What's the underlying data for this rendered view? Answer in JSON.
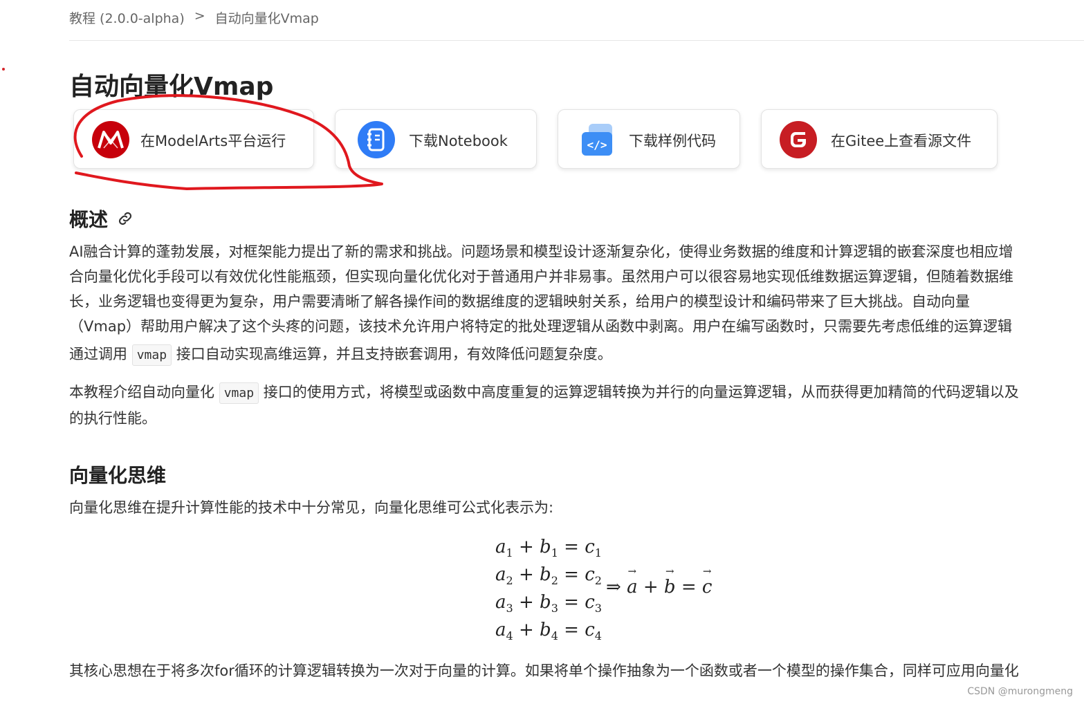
{
  "breadcrumb": {
    "parent": "教程 (2.0.0-alpha)",
    "separator": ">",
    "current": "自动向量化Vmap"
  },
  "page_title": "自动向量化Vmap",
  "cards": [
    {
      "label": "在ModelArts平台运行",
      "icon": "modelarts-icon",
      "color": "#c7000b"
    },
    {
      "label": "下载Notebook",
      "icon": "notebook-icon",
      "color": "#2f7cf6"
    },
    {
      "label": "下载样例代码",
      "icon": "code-icon",
      "color": "#3d8ef5"
    },
    {
      "label": "在Gitee上查看源文件",
      "icon": "gitee-icon",
      "color": "#c71d23"
    }
  ],
  "sections": {
    "overview": {
      "heading": "概述",
      "link_icon": "link-icon",
      "para1_lines": [
        "AI融合计算的蓬勃发展，对框架能力提出了新的需求和挑战。问题场景和模型设计逐渐复杂化，使得业务数据的维度和计算逻辑的嵌套深度也相应增",
        "合向量化优化手段可以有效优化性能瓶颈，但实现向量化优化对于普通用户并非易事。虽然用户可以很容易地实现低维数据运算逻辑，但随着数据维",
        "长，业务逻辑也变得更为复杂，用户需要清晰了解各操作间的数据维度的逻辑映射关系，给用户的模型设计和编码带来了巨大挑战。自动向量",
        "（Vmap）帮助用户解决了这个头疼的问题，该技术允许用户将特定的批处理逻辑从函数中剥离。用户在编写函数时，只需要先考虑低维的运算逻辑"
      ],
      "para1_last_pre": "通过调用",
      "para1_code": "vmap",
      "para1_last_post": "接口自动实现高维运算，并且支持嵌套调用，有效降低问题复杂度。",
      "para2_pre": "本教程介绍自动向量化",
      "para2_code": "vmap",
      "para2_post": "接口的使用方式，将模型或函数中高度重复的运算逻辑转换为并行的向量运算逻辑，从而获得更加精简的代码逻辑以及",
      "para2_line2": "的执行性能。"
    },
    "vectorization": {
      "heading": "向量化思维",
      "intro": "向量化思维在提升计算性能的技术中十分常见，向量化思维可公式化表示为:",
      "equations": [
        {
          "a": "a",
          "b": "b",
          "c": "c",
          "i": "1"
        },
        {
          "a": "a",
          "b": "b",
          "c": "c",
          "i": "2"
        },
        {
          "a": "a",
          "b": "b",
          "c": "c",
          "i": "3"
        },
        {
          "a": "a",
          "b": "b",
          "c": "c",
          "i": "4"
        }
      ],
      "implies": "⇒",
      "vector_a": "a",
      "vector_b": "b",
      "vector_c": "c",
      "plus": "+",
      "equals": "=",
      "para": "其核心思想在于将多次for循环的计算逻辑转换为一次对于向量的计算。如果将单个操作抽象为一个函数或者一个模型的操作集合，同样可应用向量化"
    }
  },
  "watermark": "CSDN @murongmeng",
  "annotation_color": "#e0181e"
}
